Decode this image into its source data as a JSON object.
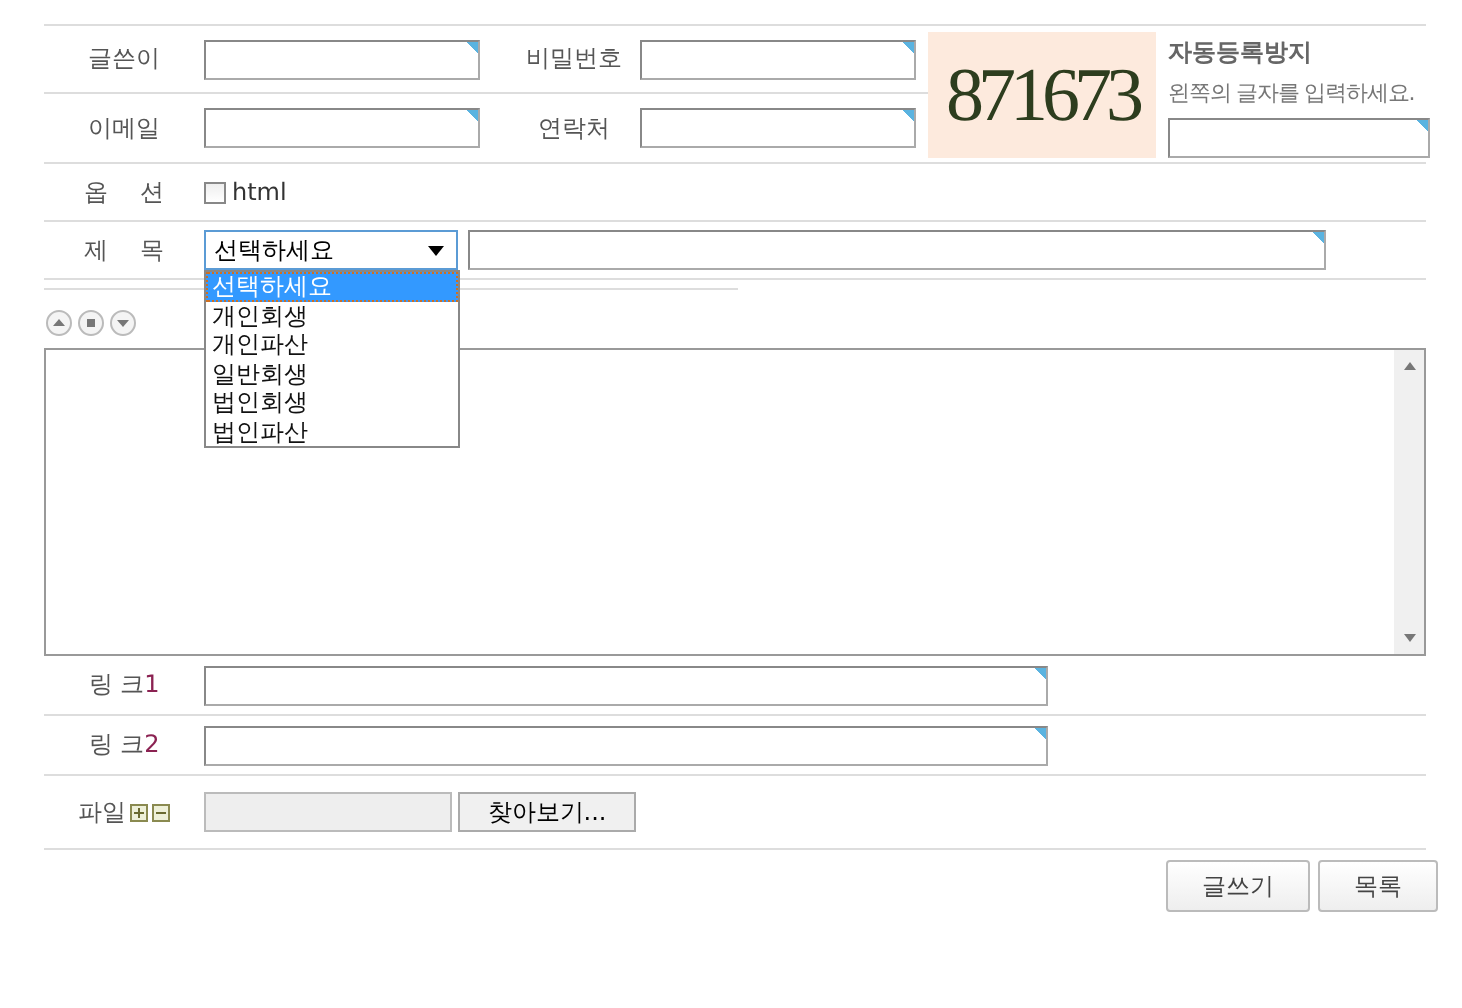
{
  "fields": [
    {
      "label": "글쓴이"
    },
    {
      "label": "비밀번호"
    },
    {
      "label": "이메일"
    },
    {
      "label": "연락처"
    }
  ],
  "captcha": {
    "code": "871673",
    "title": "자동등록방지",
    "hint": "왼쪽의 글자를 입력하세요."
  },
  "options": {
    "label": "옵 션",
    "checkbox": {
      "label": "html",
      "checked": false
    }
  },
  "subject": {
    "label": "제 목",
    "select": {
      "value": "선택하세요",
      "expanded": true,
      "options": [
        {
          "label": "선택하세요",
          "selected": true
        },
        {
          "label": "개인회생",
          "selected": false
        },
        {
          "label": "개인파산",
          "selected": false
        },
        {
          "label": "일반회생",
          "selected": false
        },
        {
          "label": "법인회생",
          "selected": false
        },
        {
          "label": "법인파산",
          "selected": false
        }
      ]
    }
  },
  "links": [
    {
      "label": "링 크",
      "number": "1"
    },
    {
      "label": "링 크",
      "number": "2"
    }
  ],
  "file": {
    "label": "파일",
    "browse": "찾아보기..."
  },
  "buttons": [
    "글쓰기",
    "목록"
  ]
}
